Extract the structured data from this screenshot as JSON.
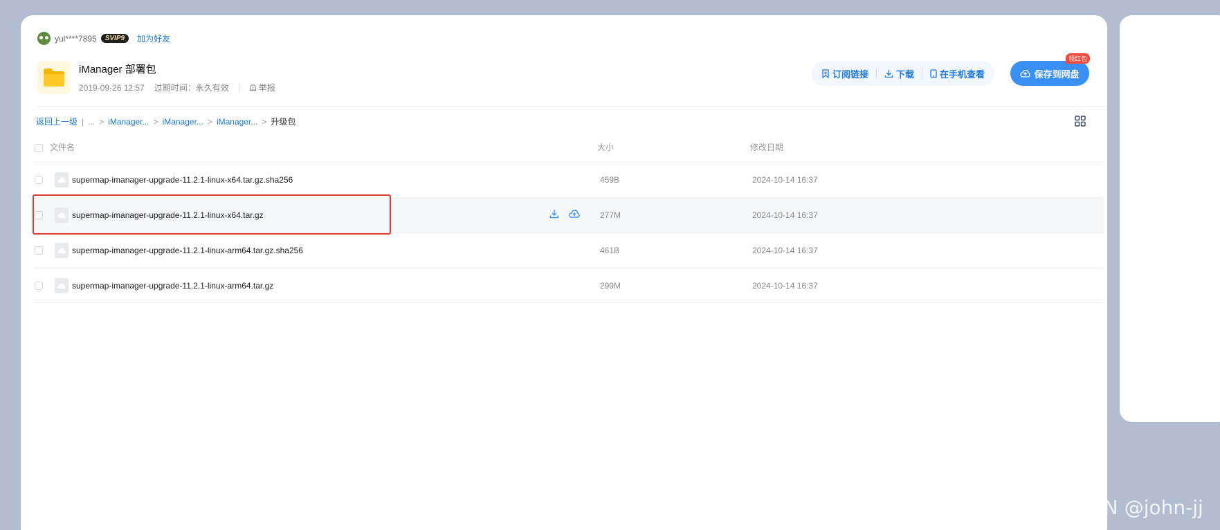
{
  "user": {
    "name": "yul****7895",
    "vip": "SVIP9",
    "add_friend": "加为好友"
  },
  "share": {
    "title": "iManager 部署包",
    "date": "2019-09-26 12:57",
    "expire": "过期时间：永久有效",
    "report": "举报"
  },
  "actions": {
    "subscribe": "订阅链接",
    "download": "下载",
    "mobile": "在手机查看",
    "save": "保存到网盘",
    "badge": "领红包"
  },
  "breadcrumb": {
    "back": "返回上一级",
    "items": [
      "...",
      "iManager...",
      "iManager...",
      "iManager..."
    ],
    "current": "升级包"
  },
  "table": {
    "headers": {
      "name": "文件名",
      "size": "大小",
      "date": "修改日期"
    },
    "rows": [
      {
        "name": "supermap-imanager-upgrade-11.2.1-linux-x64.tar.gz.sha256",
        "size": "459B",
        "date": "2024-10-14 16:37"
      },
      {
        "name": "supermap-imanager-upgrade-11.2.1-linux-x64.tar.gz",
        "size": "277M",
        "date": "2024-10-14 16:37"
      },
      {
        "name": "supermap-imanager-upgrade-11.2.1-linux-arm64.tar.gz.sha256",
        "size": "461B",
        "date": "2024-10-14 16:37"
      },
      {
        "name": "supermap-imanager-upgrade-11.2.1-linux-arm64.tar.gz",
        "size": "299M",
        "date": "2024-10-14 16:37"
      }
    ]
  },
  "watermark": "CSDN @john-jj",
  "colors": {
    "accent": "#3a8ff5",
    "link": "#1f7ae0",
    "highlight": "#e53935",
    "background": "#b2bdd2"
  }
}
